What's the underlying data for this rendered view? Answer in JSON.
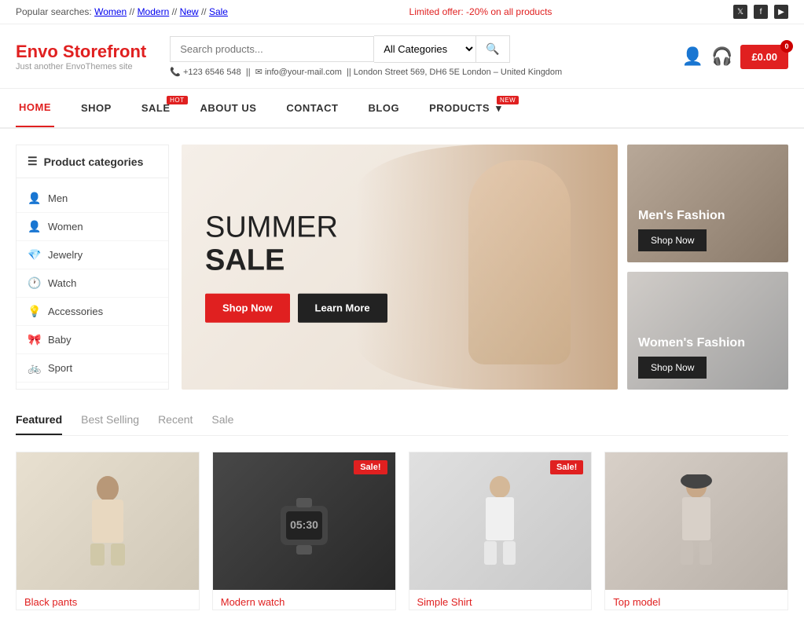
{
  "topBar": {
    "popularText": "Popular searches:",
    "popularLinks": [
      "Women",
      "Modern",
      "New",
      "Sale"
    ],
    "offerText": "Limited offer: -20% on all products",
    "socialIcons": [
      "twitter",
      "facebook",
      "youtube"
    ]
  },
  "header": {
    "logoTitle": "Envo Storefront",
    "logoSub": "Just another EnvoThemes site",
    "searchPlaceholder": "Search products...",
    "categoriesDefault": "All Categories",
    "phone": "+123 6546 548",
    "email": "info@your-mail.com",
    "address": "London Street 569, DH6 5E London – United Kingdom",
    "cartAmount": "£0.00",
    "cartCount": "0"
  },
  "nav": {
    "items": [
      {
        "label": "HOME",
        "active": true,
        "badge": null
      },
      {
        "label": "SHOP",
        "active": false,
        "badge": null
      },
      {
        "label": "SALE",
        "active": false,
        "badge": "HOT"
      },
      {
        "label": "ABOUT US",
        "active": false,
        "badge": null
      },
      {
        "label": "CONTACT",
        "active": false,
        "badge": null
      },
      {
        "label": "BLOG",
        "active": false,
        "badge": null
      },
      {
        "label": "PRODUCTS",
        "active": false,
        "badge": "NEW"
      }
    ]
  },
  "sidebar": {
    "header": "Product categories",
    "categories": [
      {
        "name": "Men",
        "icon": "👤"
      },
      {
        "name": "Women",
        "icon": "👤"
      },
      {
        "name": "Jewelry",
        "icon": "💎"
      },
      {
        "name": "Watch",
        "icon": "🕐"
      },
      {
        "name": "Accessories",
        "icon": "💡"
      },
      {
        "name": "Baby",
        "icon": "🎀"
      },
      {
        "name": "Sport",
        "icon": "🚲"
      }
    ]
  },
  "hero": {
    "line1": "SUMMER",
    "line2": "SALE",
    "shopNowLabel": "Shop Now",
    "learnMoreLabel": "Learn More"
  },
  "sideBanners": [
    {
      "title": "Men's Fashion",
      "btnLabel": "Shop Now"
    },
    {
      "title": "Women's Fashion",
      "btnLabel": "Shop Now"
    }
  ],
  "productSection": {
    "tabs": [
      {
        "label": "Featured",
        "active": true
      },
      {
        "label": "Best Selling",
        "active": false
      },
      {
        "label": "Recent",
        "active": false
      },
      {
        "label": "Sale",
        "active": false
      }
    ],
    "products": [
      {
        "name": "Black pants",
        "sale": false,
        "imgClass": "product-img-1"
      },
      {
        "name": "Modern watch",
        "sale": true,
        "imgClass": "product-img-2"
      },
      {
        "name": "Simple Shirt",
        "sale": true,
        "imgClass": "product-img-3"
      },
      {
        "name": "Top model",
        "sale": false,
        "imgClass": "product-img-4"
      }
    ],
    "saleBadgeText": "Sale!"
  },
  "colors": {
    "accent": "#e02020",
    "dark": "#222222",
    "light": "#f5f5f5"
  }
}
